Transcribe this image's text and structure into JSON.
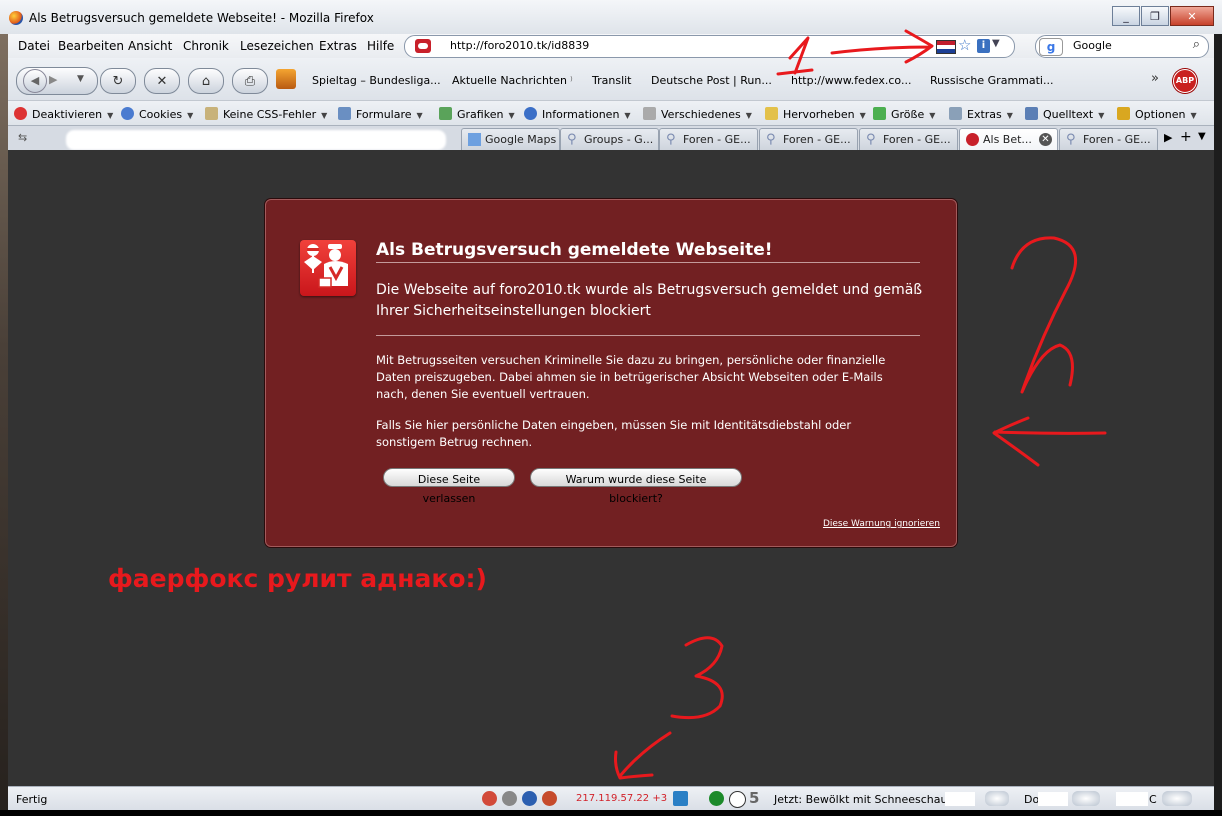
{
  "window": {
    "title": "Als Betrugsversuch gemeldete Webseite! - Mozilla Firefox",
    "buttons": [
      "_",
      "❐",
      "✕"
    ]
  },
  "menubar": [
    "Datei",
    "Bearbeiten",
    "Ansicht",
    "Chronik",
    "Lesezeichen",
    "Extras",
    "Hilfe"
  ],
  "urlbar": {
    "url": "http://foro2010.tk/id8839"
  },
  "search": {
    "engine": "Google",
    "placeholder": "Google"
  },
  "bookmarks": [
    "Spieltag – Bundesliga...",
    "Aktuelle Nachrichten",
    "Translit",
    "Deutsche Post | Run...",
    "http://www.fedex.co...",
    "Russische Grammati..."
  ],
  "abp": "ABP",
  "devbar": [
    "Deaktivieren",
    "Cookies",
    "Keine CSS-Fehler",
    "Formulare",
    "Grafiken",
    "Informationen",
    "Verschiedenes",
    "Hervorheben",
    "Größe",
    "Extras",
    "Quelltext",
    "Optionen"
  ],
  "tabs": [
    {
      "label": "Google Maps"
    },
    {
      "label": "Groups - G..."
    },
    {
      "label": "Foren - GE..."
    },
    {
      "label": "Foren - GE..."
    },
    {
      "label": "Foren - GE..."
    },
    {
      "label": "Als Bet...",
      "active": true
    },
    {
      "label": "Foren - GE..."
    }
  ],
  "warning": {
    "title": "Als Betrugsversuch gemeldete Webseite!",
    "lead": "Die Webseite auf foro2010.tk wurde als Betrugsversuch gemeldet und gemäß Ihrer Sicherheitseinstellungen blockiert",
    "p1": "Mit Betrugsseiten versuchen Kriminelle Sie dazu zu bringen, persönliche oder finanzielle Daten preiszugeben. Dabei ahmen sie in betrügerischer Absicht Webseiten oder E-Mails nach, denen Sie eventuell vertrauen.",
    "p2": "Falls Sie hier persönliche Daten eingeben, müssen Sie mit Identitätsdiebstahl oder sonstigem Betrug rechnen.",
    "btn_leave": "Diese Seite verlassen",
    "btn_why": "Warum wurde diese Seite blockiert?",
    "ignore": "Diese Warnung ignorieren",
    "colors": {
      "background": "#722022",
      "icon": "#e8302e"
    }
  },
  "annotation": {
    "text": "фаерфокс рулит аднако:)",
    "color": "#e8191d",
    "numbers": [
      "1",
      "2",
      "3"
    ]
  },
  "statusbar": {
    "left": "Fertig",
    "ip": "217.119.57.22 +3",
    "count": "5",
    "weather": "Jetzt: Bewölkt mit Schneeschauern,",
    "do": "Do:",
    "fr": "C"
  }
}
